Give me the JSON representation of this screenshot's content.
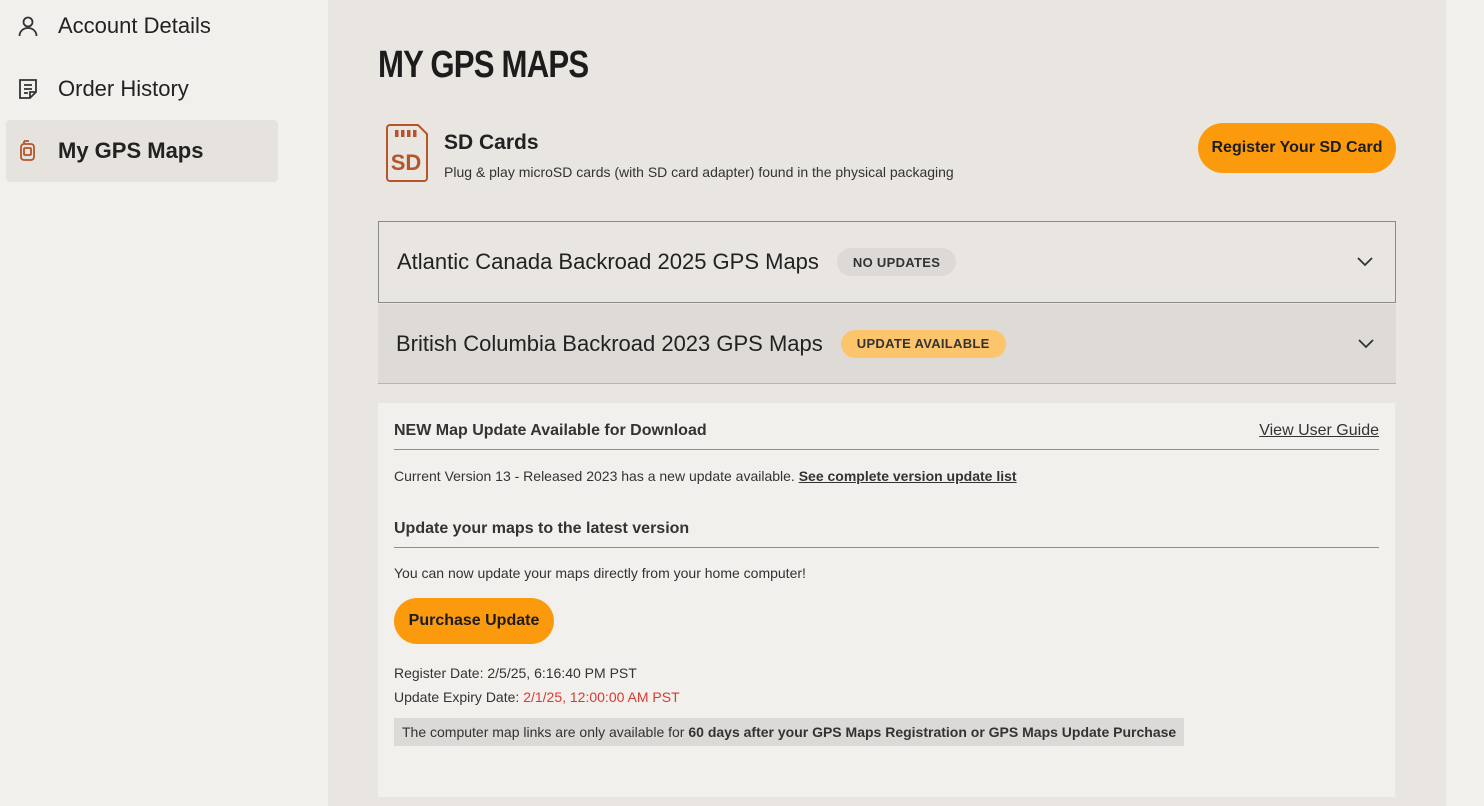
{
  "sidebar": {
    "items": [
      {
        "label": "Account Details",
        "icon": "user-icon"
      },
      {
        "label": "Order History",
        "icon": "document-icon"
      },
      {
        "label": "My GPS Maps",
        "icon": "gps-device-icon",
        "active": true
      }
    ]
  },
  "main": {
    "title": "MY GPS MAPS",
    "sd": {
      "icon_text": "SD",
      "title": "SD Cards",
      "subtitle": "Plug & play microSD cards (with SD card adapter) found in the physical packaging",
      "register_label": "Register Your SD Card"
    },
    "maps": [
      {
        "title": "Atlantic Canada Backroad 2025 GPS Maps",
        "badge": "NO UPDATES"
      },
      {
        "title": "British Columbia Backroad 2023 GPS Maps",
        "badge": "UPDATE AVAILABLE",
        "expanded": true
      }
    ],
    "panel": {
      "heading": "NEW Map Update Available for Download",
      "guide_link": "View User Guide",
      "version_text": "Current Version 13 - Released 2023 has a new update available.",
      "version_link": "See complete version update list",
      "update_heading": "Update your maps to the latest version",
      "update_text": "You can now update your maps directly from your home computer!",
      "purchase_label": "Purchase Update",
      "register_date_label": "Register Date:",
      "register_date": "2/5/25, 6:16:40 PM PST",
      "expiry_label": "Update Expiry Date:",
      "expiry_date": "2/1/25, 12:00:00 AM PST",
      "note_text": "The computer map links are only available for",
      "note_bold": "60 days after your GPS Maps Registration or GPS Maps Update Purchase"
    }
  },
  "colors": {
    "accent": "#fb9a0d",
    "expiry": "#d93a32",
    "icon": "#b5552a"
  }
}
